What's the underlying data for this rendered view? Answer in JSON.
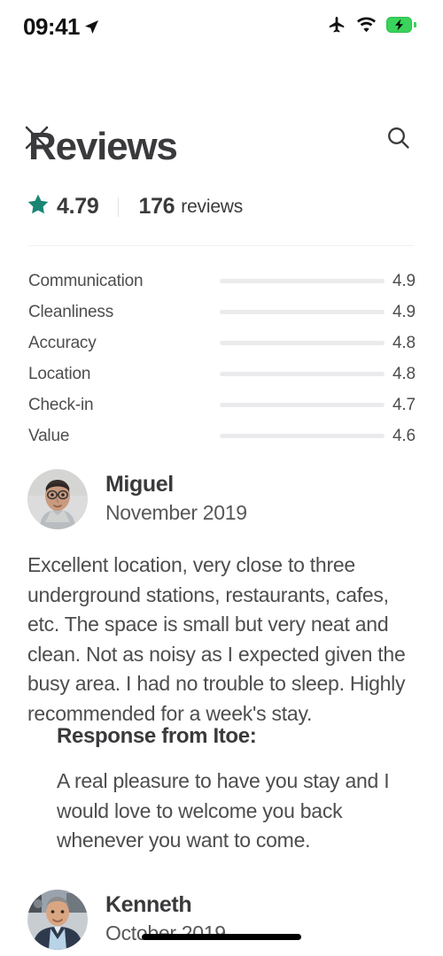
{
  "status_bar": {
    "time": "09:41",
    "location_icon": "location-arrow-icon",
    "airplane_icon": "airplane-mode-icon",
    "wifi_icon": "wifi-icon",
    "battery_icon": "battery-charging-icon",
    "battery_color": "#3ad35b"
  },
  "nav": {
    "close_icon": "close-icon",
    "search_icon": "search-icon"
  },
  "header": {
    "title": "Reviews",
    "star_icon": "star-icon",
    "accent_color": "#1a8573",
    "rating": "4.79",
    "review_count": "176",
    "review_count_label": "reviews"
  },
  "category_ratings": [
    {
      "label": "Communication",
      "value": "4.9",
      "percent": 98
    },
    {
      "label": "Cleanliness",
      "value": "4.9",
      "percent": 98
    },
    {
      "label": "Accuracy",
      "value": "4.8",
      "percent": 96
    },
    {
      "label": "Location",
      "value": "4.8",
      "percent": 96
    },
    {
      "label": "Check-in",
      "value": "4.7",
      "percent": 94
    },
    {
      "label": "Value",
      "value": "4.6",
      "percent": 92
    }
  ],
  "reviews": [
    {
      "name": "Miguel",
      "date": "November 2019",
      "avatar": "avatar",
      "text": "Excellent location, very close to three underground stations, restaurants, cafes, etc. The space is small but very neat and clean. Not as noisy as I expected given the busy area. I had no trouble to sleep. Highly recommended for a week's stay.",
      "response_title": "Response from Itoe:",
      "response_text": "A real pleasure to have you stay and I would love to welcome you back whenever you want to come."
    },
    {
      "name": "Kenneth",
      "date": "October 2019",
      "avatar": "avatar"
    }
  ]
}
